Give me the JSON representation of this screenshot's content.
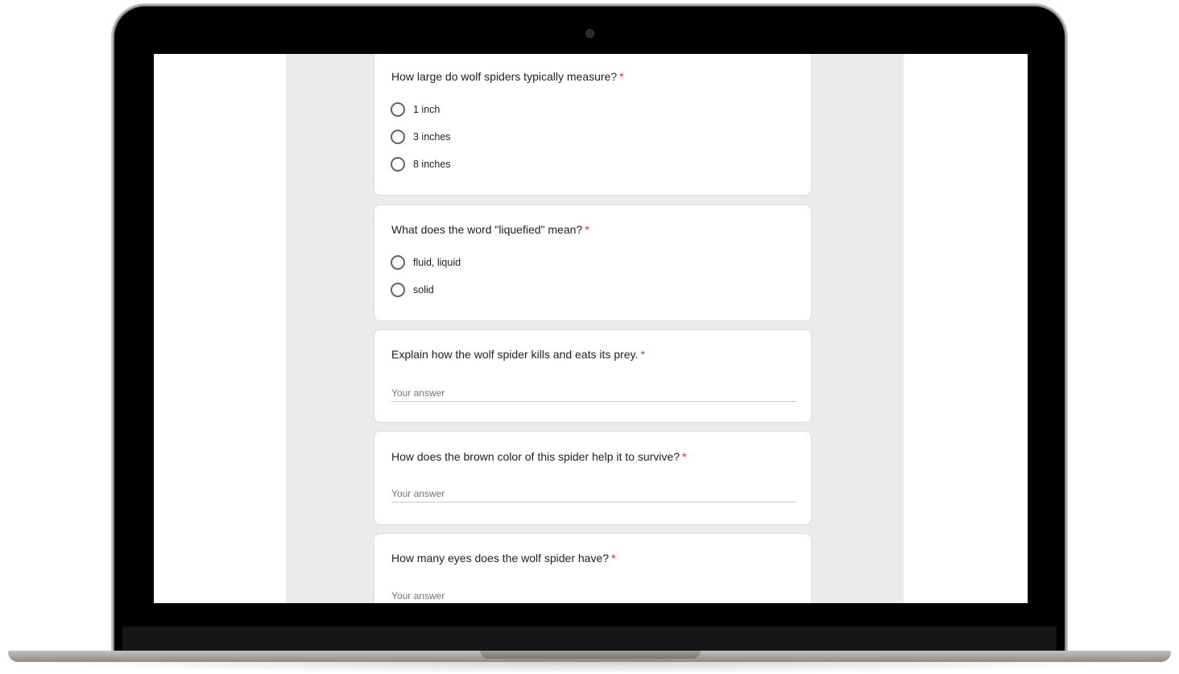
{
  "form": {
    "questions": [
      {
        "title": "How large do wolf spiders typically measure?",
        "required_mark": "*",
        "type": "radio",
        "options": [
          "1 inch",
          "3 inches",
          "8 inches"
        ]
      },
      {
        "title": "What does the word \"liquefied\" mean?",
        "required_mark": "*",
        "type": "radio",
        "options": [
          "fluid, liquid",
          "solid"
        ]
      },
      {
        "title": "Explain how the wolf spider kills and eats its prey.",
        "required_mark": "*",
        "type": "text",
        "placeholder": "Your answer"
      },
      {
        "title": "How does the brown color of this spider help it to survive?",
        "required_mark": "*",
        "type": "text",
        "placeholder": "Your answer"
      },
      {
        "title": "How many eyes does the wolf spider have?",
        "required_mark": "*",
        "type": "text",
        "placeholder": "Your answer"
      }
    ]
  },
  "colors": {
    "required": "#d93025",
    "form_background": "#ebebeb",
    "card_border": "#dadce0",
    "device_frame": "#000000"
  }
}
